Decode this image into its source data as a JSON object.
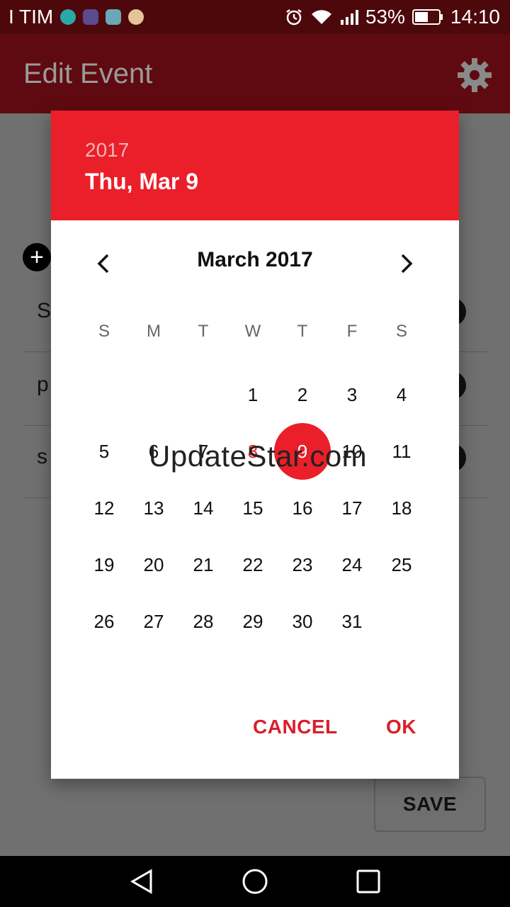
{
  "status_bar": {
    "carrier": "I TIM",
    "battery": "53%",
    "time": "14:10"
  },
  "app_bar": {
    "title": "Edit Event",
    "settings_icon": "gear-icon"
  },
  "background": {
    "rows": [
      {
        "initial": "S"
      },
      {
        "initial": "p"
      },
      {
        "initial": "s"
      }
    ],
    "save_label": "SAVE"
  },
  "date_picker": {
    "header": {
      "year": "2017",
      "date": "Thu, Mar 9"
    },
    "month_label": "March 2017",
    "weekday_labels": [
      "S",
      "M",
      "T",
      "W",
      "T",
      "F",
      "S"
    ],
    "leading_blanks": 3,
    "days": [
      "1",
      "2",
      "3",
      "4",
      "5",
      "6",
      "7",
      "8",
      "9",
      "10",
      "11",
      "12",
      "13",
      "14",
      "15",
      "16",
      "17",
      "18",
      "19",
      "20",
      "21",
      "22",
      "23",
      "24",
      "25",
      "26",
      "27",
      "28",
      "29",
      "30",
      "31"
    ],
    "today": "8",
    "selected": "9",
    "actions": {
      "cancel": "CANCEL",
      "ok": "OK"
    },
    "accent_color": "#ea1f2a"
  },
  "watermark": "UpdateStar.com"
}
